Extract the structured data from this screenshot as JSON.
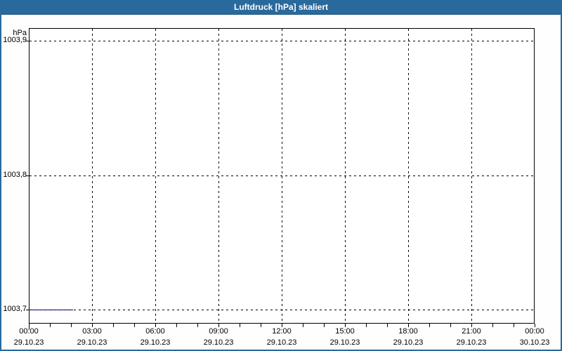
{
  "window": {
    "title": "Luftdruck [hPa] skaliert"
  },
  "colors": {
    "titlebar_bg": "#2a699c",
    "titlebar_text": "#ffffff",
    "window_border": "#2a699c",
    "plot_border": "#000000",
    "grid": "#000000",
    "label_text": "#000000",
    "series": "#0000a0",
    "plot_bg": "#ffffff"
  },
  "chart_data": {
    "type": "line",
    "title": "Luftdruck [hPa] skaliert",
    "ylabel": "hPa",
    "xlabel": "",
    "ylim": [
      1003.69,
      1003.91
    ],
    "xlim_hours": [
      0,
      24
    ],
    "grid": "dashed",
    "legend": "none",
    "y_ticks": [
      {
        "label": "1003,9",
        "value": 1003.9
      },
      {
        "label": "1003,8",
        "value": 1003.8
      },
      {
        "label": "1003,7",
        "value": 1003.7
      }
    ],
    "x_ticks": [
      {
        "hour": 0,
        "time": "00:00",
        "date": "29.10.23"
      },
      {
        "hour": 3,
        "time": "03:00",
        "date": "29.10.23"
      },
      {
        "hour": 6,
        "time": "06:00",
        "date": "29.10.23"
      },
      {
        "hour": 9,
        "time": "09:00",
        "date": "29.10.23"
      },
      {
        "hour": 12,
        "time": "12:00",
        "date": "29.10.23"
      },
      {
        "hour": 15,
        "time": "15:00",
        "date": "29.10.23"
      },
      {
        "hour": 18,
        "time": "18:00",
        "date": "29.10.23"
      },
      {
        "hour": 21,
        "time": "21:00",
        "date": "29.10.23"
      },
      {
        "hour": 24,
        "time": "00:00",
        "date": "30.10.23"
      }
    ],
    "x_minor_tick_every_hours": 1,
    "series": [
      {
        "name": "Luftdruck",
        "unit": "hPa",
        "color": "#0000a0",
        "points": [
          {
            "hour": 0.0,
            "value": 1003.7
          },
          {
            "hour": 2.1,
            "value": 1003.7
          }
        ]
      }
    ]
  }
}
